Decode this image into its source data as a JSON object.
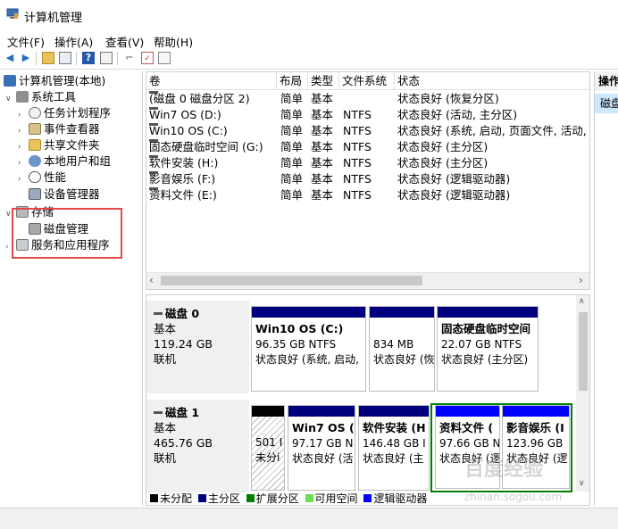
{
  "window": {
    "title": "计算机管理"
  },
  "menu": [
    "文件(F)",
    "操作(A)",
    "查看(V)",
    "帮助(H)"
  ],
  "tree": {
    "root": "计算机管理(本地)",
    "system_tools": "系统工具",
    "items": [
      "任务计划程序",
      "事件查看器",
      "共享文件夹",
      "本地用户和组",
      "性能",
      "设备管理器"
    ],
    "storage": "存储",
    "disk_management": "磁盘管理",
    "services": "服务和应用程序"
  },
  "volume_table": {
    "headers": [
      "卷",
      "布局",
      "类型",
      "文件系统",
      "状态"
    ],
    "rows": [
      {
        "name": "(磁盘 0 磁盘分区 2)",
        "layout": "简单",
        "type": "基本",
        "fs": "",
        "status": "状态良好 (恢复分区)"
      },
      {
        "name": "Win7 OS (D:)",
        "layout": "简单",
        "type": "基本",
        "fs": "NTFS",
        "status": "状态良好 (活动, 主分区)"
      },
      {
        "name": "Win10 OS (C:)",
        "layout": "简单",
        "type": "基本",
        "fs": "NTFS",
        "status": "状态良好 (系统, 启动, 页面文件, 活动, 故"
      },
      {
        "name": "固态硬盘临时空间 (G:)",
        "layout": "简单",
        "type": "基本",
        "fs": "NTFS",
        "status": "状态良好 (主分区)"
      },
      {
        "name": "软件安装 (H:)",
        "layout": "简单",
        "type": "基本",
        "fs": "NTFS",
        "status": "状态良好 (主分区)"
      },
      {
        "name": "影音娱乐 (F:)",
        "layout": "简单",
        "type": "基本",
        "fs": "NTFS",
        "status": "状态良好 (逻辑驱动器)"
      },
      {
        "name": "资料文件 (E:)",
        "layout": "简单",
        "type": "基本",
        "fs": "NTFS",
        "status": "状态良好 (逻辑驱动器)"
      }
    ]
  },
  "disks": [
    {
      "name": "磁盘 0",
      "type": "基本",
      "size": "119.24 GB",
      "state": "联机",
      "partitions": [
        {
          "title": "Win10 OS  (C:)",
          "size": "96.35 GB NTFS",
          "status": "状态良好 (系统, 启动,"
        },
        {
          "title": "",
          "size": "834 MB",
          "status": "状态良好 (恢"
        },
        {
          "title": "固态硬盘临时空间",
          "size": "22.07 GB NTFS",
          "status": "状态良好 (主分区)"
        }
      ]
    },
    {
      "name": "磁盘 1",
      "type": "基本",
      "size": "465.76 GB",
      "state": "联机",
      "partitions": [
        {
          "title": "",
          "size": "501 I",
          "status": "未分i"
        },
        {
          "title": "Win7 OS  (",
          "size": "97.17 GB N",
          "status": "状态良好 (活"
        },
        {
          "title": "软件安装  (H",
          "size": "146.48 GB I",
          "status": "状态良好 (主"
        },
        {
          "title": "资料文件  (",
          "size": "97.66 GB N",
          "status": "状态良好 (逻"
        },
        {
          "title": "影音娱乐  (I",
          "size": "123.96 GB",
          "status": "状态良好 (逻"
        }
      ]
    }
  ],
  "legend": [
    "未分配",
    "主分区",
    "扩展分区",
    "可用空间",
    "逻辑驱动器"
  ],
  "actions": {
    "header": "操作",
    "item": "磁盘"
  },
  "watermark": {
    "text": "百度经验",
    "url": "zhinan.sogou.com"
  },
  "colors": {
    "primary": "#00007f",
    "logical": "#0000ff",
    "extended": "#008000",
    "free": "#66e04c",
    "unallocated": "#000000",
    "selection": "#cce8ff",
    "highlight": "#e14848"
  }
}
